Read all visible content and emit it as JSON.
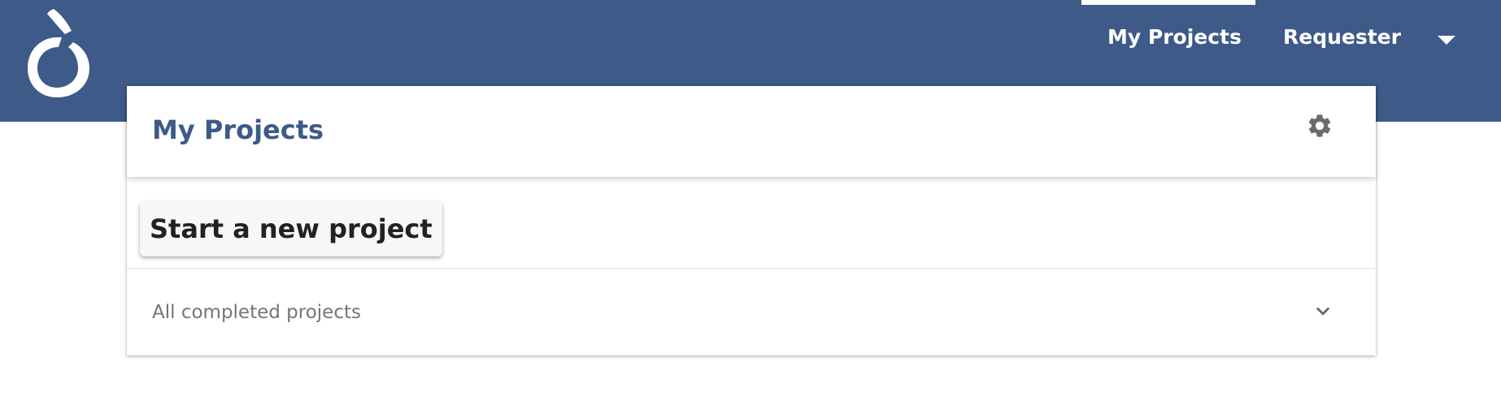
{
  "nav": {
    "items": [
      {
        "label": "My Projects",
        "active": true
      },
      {
        "label": "Requester"
      }
    ]
  },
  "header": {
    "title": "My Projects"
  },
  "actions": {
    "new_project_label": "Start a new project"
  },
  "completed": {
    "label": "All completed projects"
  },
  "icons": {
    "logo": "logo-icon",
    "caret": "caret-down-icon",
    "settings": "gear-icon",
    "expand": "chevron-down-icon"
  },
  "colors": {
    "brand": "#3d5a88",
    "title": "#3d5a88",
    "muted_text": "#757575",
    "button_bg": "#f7f7f7"
  }
}
